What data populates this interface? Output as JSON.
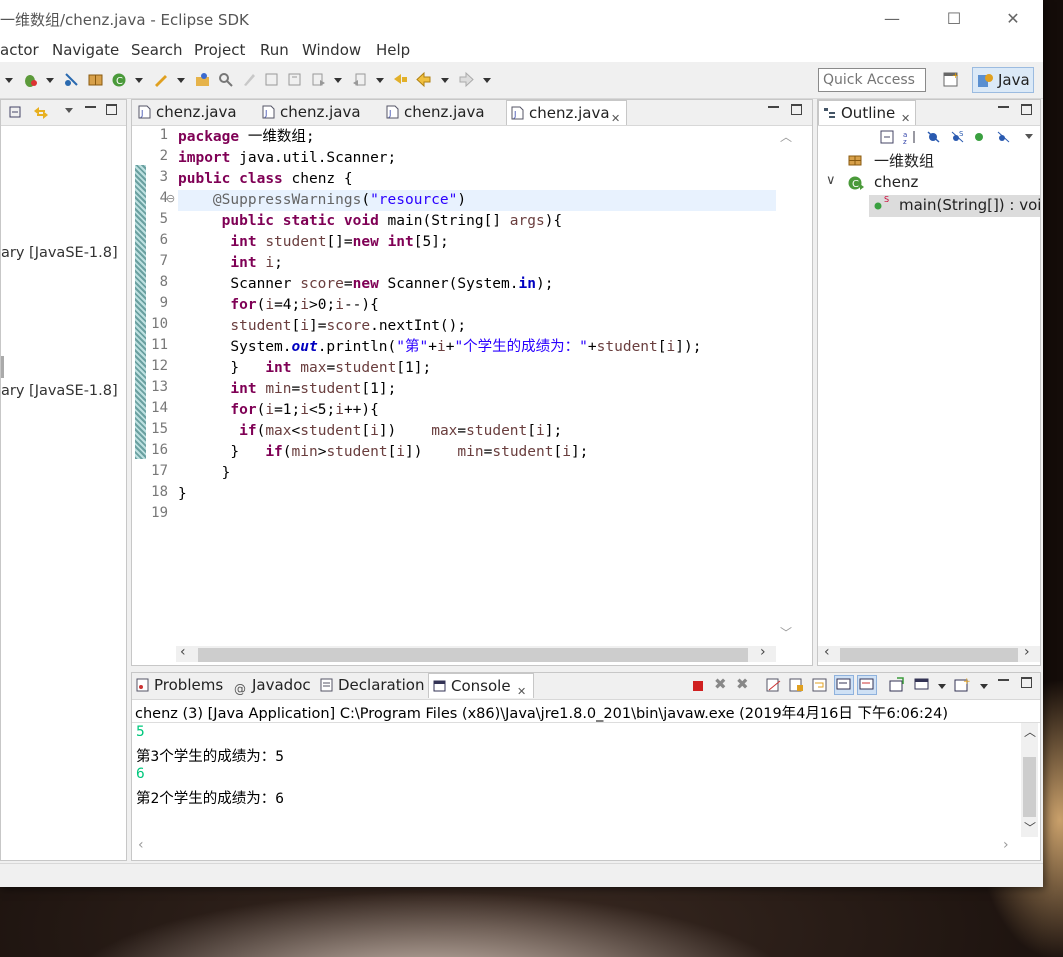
{
  "window": {
    "title": "一维数组/chenz.java - Eclipse SDK",
    "min": "—",
    "max": "☐",
    "close": "✕"
  },
  "menu": [
    "actor",
    "Navigate",
    "Search",
    "Project",
    "Run",
    "Window",
    "Help"
  ],
  "toolbar": {
    "quick_access_placeholder": "Quick Access",
    "perspective": "Java"
  },
  "left_panel": {
    "lib1": "ary [JavaSE-1.8]",
    "lib2": "ary [JavaSE-1.8]"
  },
  "editor": {
    "tabs": [
      {
        "label": "chenz.java",
        "active": false
      },
      {
        "label": "chenz.java",
        "active": false
      },
      {
        "label": "chenz.java",
        "active": false
      },
      {
        "label": "chenz.java",
        "active": true
      }
    ],
    "line_numbers": [
      "1",
      "2",
      "3",
      "4",
      "5",
      "6",
      "7",
      "8",
      "9",
      "10",
      "11",
      "12",
      "13",
      "14",
      "15",
      "16",
      "17",
      "18",
      "19"
    ],
    "fold_marker": "⊖"
  },
  "outline": {
    "title": "Outline",
    "items": [
      {
        "label": "一维数组"
      },
      {
        "label": "chenz"
      },
      {
        "label": "main(String[]) : void"
      }
    ]
  },
  "console": {
    "tabs": [
      {
        "label": "Problems"
      },
      {
        "label": "Javadoc"
      },
      {
        "label": "Declaration"
      },
      {
        "label": "Console"
      }
    ],
    "header": "chenz (3) [Java Application] C:\\Program Files (x86)\\Java\\jre1.8.0_201\\bin\\javaw.exe (2019年4月16日 下午6:06:24)",
    "lines": [
      {
        "text": "5",
        "input": true
      },
      {
        "text": "第3个学生的成绩为：5",
        "input": false
      },
      {
        "text": "6",
        "input": true
      },
      {
        "text": "第2个学生的成绩为：6",
        "input": false
      }
    ]
  },
  "colors": {
    "keyword": "#7f0055",
    "string": "#2a00ff",
    "stdin": "#00c87d",
    "line_highlight": "#e8f2fe"
  }
}
